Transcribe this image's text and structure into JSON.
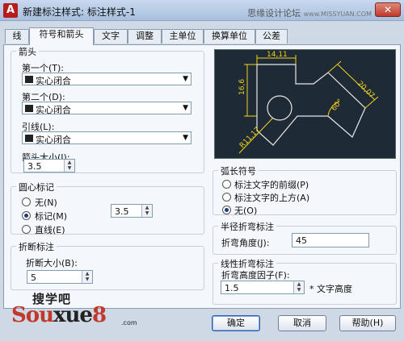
{
  "window": {
    "icon_label": "A",
    "title": "新建标注样式: 标注样式-1",
    "watermark": "思缘设计论坛",
    "watermark_url": "www.MISSYUAN.COM",
    "close_label": "✕"
  },
  "tabs": [
    {
      "label": "线"
    },
    {
      "label": "符号和箭头"
    },
    {
      "label": "文字"
    },
    {
      "label": "调整"
    },
    {
      "label": "主单位"
    },
    {
      "label": "换算单位"
    },
    {
      "label": "公差"
    }
  ],
  "arrows": {
    "title": "箭头",
    "first_label": "第一个(T):",
    "first_value": "实心闭合",
    "second_label": "第二个(D):",
    "second_value": "实心闭合",
    "leader_label": "引线(L):",
    "leader_value": "实心闭合",
    "size_label": "箭头大小(I):",
    "size_value": "3.5"
  },
  "center_mark": {
    "title": "圆心标记",
    "none_label": "无(N)",
    "mark_label": "标记(M)",
    "line_label": "直线(E)",
    "selected": "mark",
    "size_value": "3.5"
  },
  "break": {
    "title": "折断标注",
    "size_label": "折断大小(B):",
    "size_value": "5"
  },
  "preview": {
    "dim_top": "14,11",
    "dim_left": "16,6",
    "dim_right": "20,07",
    "dim_angle": "60°",
    "dim_radius": "R11,17"
  },
  "arc_length": {
    "title": "弧长符号",
    "prefix_label": "标注文字的前缀(P)",
    "above_label": "标注文字的上方(A)",
    "none_label": "无(O)",
    "selected": "none"
  },
  "radius_jog": {
    "title": "半径折弯标注",
    "angle_label": "折弯角度(J):",
    "angle_value": "45"
  },
  "linear_jog": {
    "title": "线性折弯标注",
    "factor_label": "折弯高度因子(F):",
    "factor_value": "1.5",
    "suffix": "* 文字高度"
  },
  "buttons": {
    "ok": "确定",
    "cancel": "取消",
    "help": "帮助(H)"
  },
  "logo": {
    "cn": "搜学吧",
    "en_a": "Sou",
    "en_b": "xue",
    "en_c": "8",
    "com": ".com"
  },
  "colors": {
    "preview_bg": "#1e2a36",
    "preview_lines": "#e8e8e8",
    "preview_dims": "#f2d21c"
  }
}
